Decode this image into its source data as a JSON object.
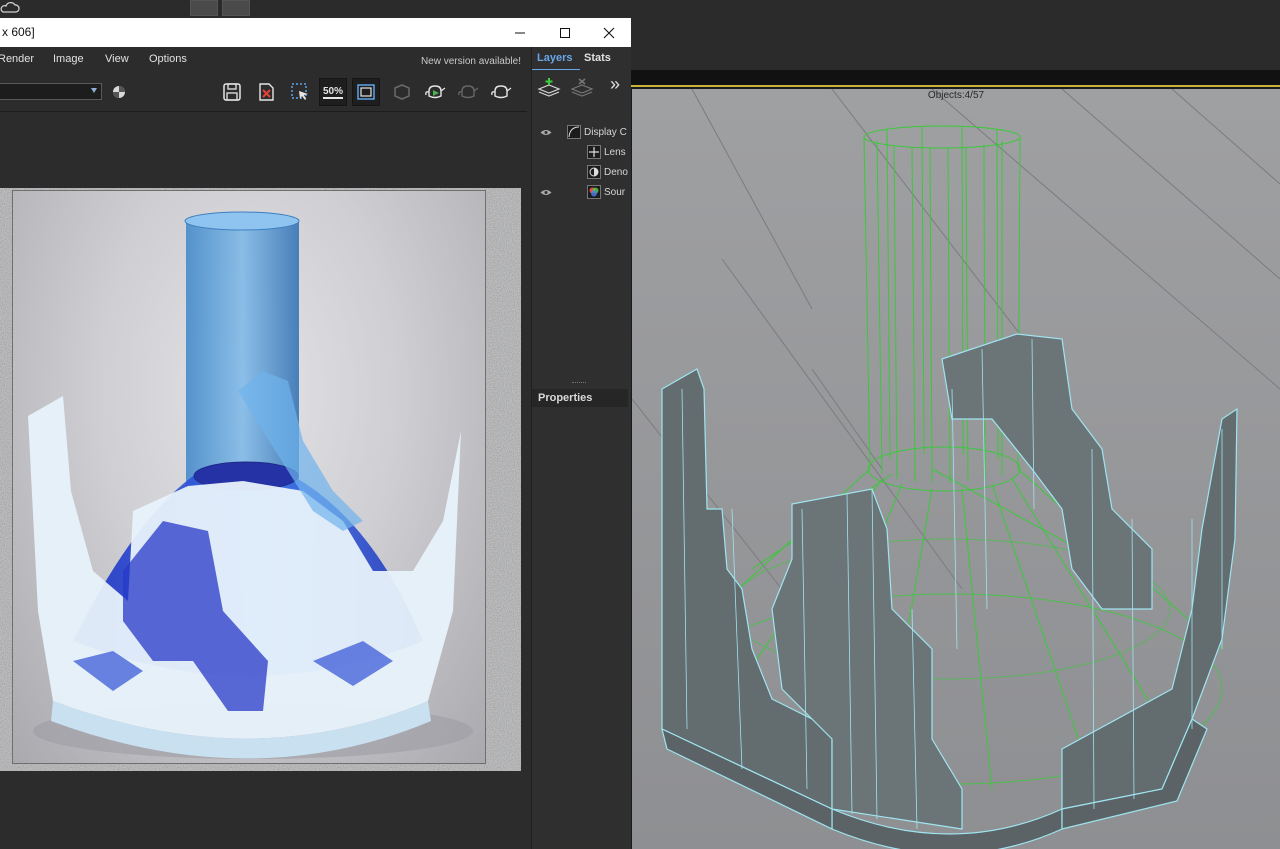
{
  "window": {
    "title": "x 606]",
    "minimize_label": "—",
    "maximize_label": "☐",
    "close_label": "✕"
  },
  "menu": {
    "items": [
      "Render",
      "Image",
      "View",
      "Options"
    ],
    "new_version": "New version available!"
  },
  "toolbar": {
    "zoom_label": "50%",
    "icons": [
      "save-icon",
      "clear-icon",
      "region-select-icon",
      "zoom-icon",
      "frame-icon",
      "track-mouse-icon",
      "render-teapot-icon",
      "render-teapot-disabled-icon",
      "stop-teapot-icon"
    ]
  },
  "side_panel": {
    "tabs": [
      "Layers",
      "Stats"
    ],
    "more_label": "»",
    "layers": [
      {
        "label": "Display C",
        "visible": true,
        "icon": "display-correction-icon"
      },
      {
        "label": "Lens",
        "visible": false,
        "icon": "lens-effects-icon"
      },
      {
        "label": "Deno",
        "visible": false,
        "icon": "denoiser-icon"
      },
      {
        "label": "Sour",
        "visible": true,
        "icon": "source-icon"
      }
    ],
    "properties_label": "Properties"
  },
  "viewport": {
    "objects_label": "Objects:4/57"
  },
  "colors": {
    "accent_blue": "#67a7e6",
    "wire_green": "#3bc93b",
    "wire_cyan": "#9fe4f0",
    "viewport_frame_yellow": "#c9b23a"
  }
}
